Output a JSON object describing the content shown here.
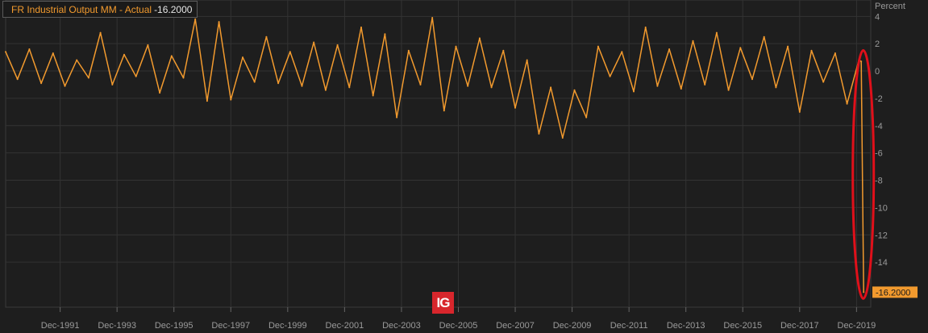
{
  "legend": {
    "series_name": "FR Industrial Output MM - Actual",
    "last_value": "-16.2000"
  },
  "watermark": "IG",
  "colors": {
    "background": "#1e1e1e",
    "grid": "#333333",
    "series": "#f29a2e",
    "highlight": "#e0101a",
    "text": "#9a9a9a"
  },
  "chart_data": {
    "type": "line",
    "ylabel": "Percent",
    "ylim": [
      -17.3,
      5.2
    ],
    "y_ticks": [
      4,
      2,
      0,
      -2,
      -4,
      -6,
      -8,
      -10,
      -12,
      -14
    ],
    "xlim": [
      "1990-01",
      "2020-06"
    ],
    "x_ticks": [
      "Dec-1991",
      "Dec-1993",
      "Dec-1995",
      "Dec-1997",
      "Dec-1999",
      "Dec-2001",
      "Dec-2003",
      "Dec-2005",
      "Dec-2007",
      "Dec-2009",
      "Dec-2011",
      "Dec-2013",
      "Dec-2015",
      "Dec-2017",
      "Dec-2019"
    ],
    "last_value_label": "-16.2000",
    "annotation": "red ellipse around the March 2020 drop",
    "grid": true,
    "series": [
      {
        "x": [
          "1990-01",
          "1990-06",
          "1990-11",
          "1991-04",
          "1991-09",
          "1992-02",
          "1992-07",
          "1992-12",
          "1993-05",
          "1993-10",
          "1994-03",
          "1994-08",
          "1995-01",
          "1995-06",
          "1995-11",
          "1996-04",
          "1996-09",
          "1997-02",
          "1997-07",
          "1997-12",
          "1998-05",
          "1998-10",
          "1999-03",
          "1999-08",
          "2000-01",
          "2000-06",
          "2000-11",
          "2001-04",
          "2001-09",
          "2002-02",
          "2002-07",
          "2002-12",
          "2003-05",
          "2003-10",
          "2004-03",
          "2004-08",
          "2005-01",
          "2005-06",
          "2005-11",
          "2006-04",
          "2006-09",
          "2007-02",
          "2007-07",
          "2007-12",
          "2008-05",
          "2008-10",
          "2009-03",
          "2009-08",
          "2010-01",
          "2010-06",
          "2010-11",
          "2011-04",
          "2011-09",
          "2012-02",
          "2012-07",
          "2012-12",
          "2013-05",
          "2013-10",
          "2014-03",
          "2014-08",
          "2015-01",
          "2015-06",
          "2015-11",
          "2016-04",
          "2016-09",
          "2017-02",
          "2017-07",
          "2017-12",
          "2018-05",
          "2018-10",
          "2019-03",
          "2019-08",
          "2020-01",
          "2020-02",
          "2020-03"
        ],
        "values": [
          1.4,
          -0.6,
          1.6,
          -0.9,
          1.3,
          -1.1,
          0.8,
          -0.5,
          2.8,
          -1.0,
          1.2,
          -0.4,
          1.9,
          -1.6,
          1.1,
          -0.5,
          3.8,
          -2.2,
          3.6,
          -2.1,
          1.0,
          -0.8,
          2.5,
          -0.9,
          1.4,
          -1.1,
          2.1,
          -1.4,
          1.9,
          -1.2,
          3.2,
          -1.8,
          2.7,
          -3.4,
          1.5,
          -1.0,
          3.9,
          -2.9,
          1.8,
          -1.1,
          2.4,
          -1.2,
          1.5,
          -2.7,
          0.8,
          -4.6,
          -1.2,
          -4.9,
          -1.4,
          -3.4,
          1.8,
          -0.4,
          1.4,
          -1.5,
          3.2,
          -1.1,
          1.6,
          -1.3,
          2.2,
          -1.0,
          2.8,
          -1.4,
          1.7,
          -0.6,
          2.5,
          -1.2,
          1.8,
          -3.0,
          1.5,
          -0.8,
          1.3,
          -2.4,
          0.8,
          0.7,
          -16.2
        ]
      }
    ]
  }
}
